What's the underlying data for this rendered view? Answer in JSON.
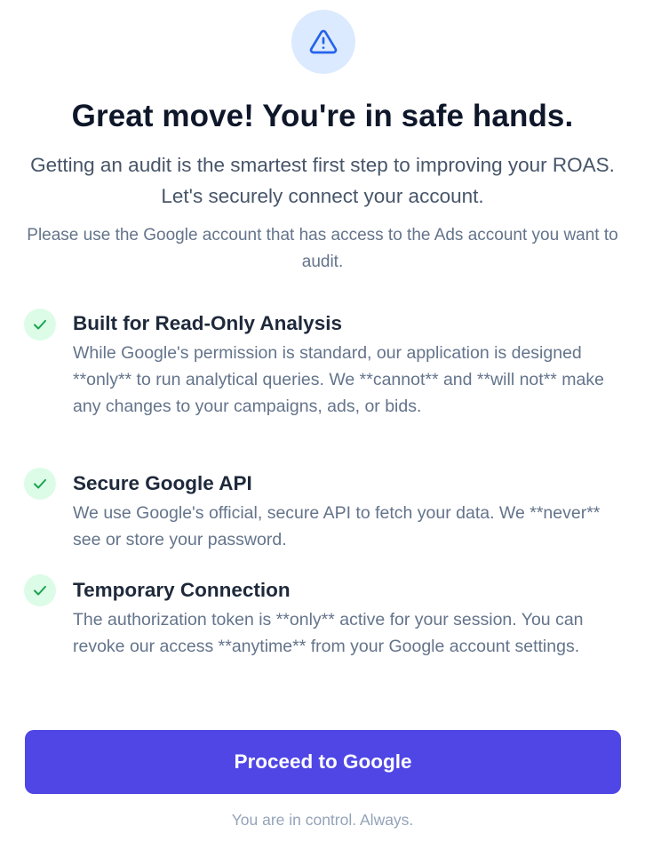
{
  "header": {
    "icon": "warning-triangle-icon",
    "title": "Great move! You're in safe hands.",
    "subtitle": "Getting an audit is the smartest first step to improving your ROAS. Let's securely connect your account.",
    "note": "Please use the Google account that has access to the Ads account you want to audit."
  },
  "features": [
    {
      "icon": "check-icon",
      "title": "Built for Read-Only Analysis",
      "description": "While Google's permission is standard, our application is designed **only** to run analytical queries. We **cannot** and **will not** make any changes to your campaigns, ads, or bids."
    },
    {
      "icon": "check-icon",
      "title": "Secure Google API",
      "description": "We use Google's official, secure API to fetch your data. We **never** see or store your password."
    },
    {
      "icon": "check-icon",
      "title": "Temporary Connection",
      "description": "The authorization token is **only** active for your session. You can revoke our access **anytime** from your Google account settings."
    }
  ],
  "actions": {
    "proceed_label": "Proceed to Google"
  },
  "footer": {
    "text": "You are in control. Always."
  },
  "colors": {
    "accent": "#4f46e5",
    "warning_bg": "#dbeafe",
    "warning_fg": "#2563eb",
    "check_bg": "#dcfce7",
    "check_fg": "#16a34a"
  }
}
